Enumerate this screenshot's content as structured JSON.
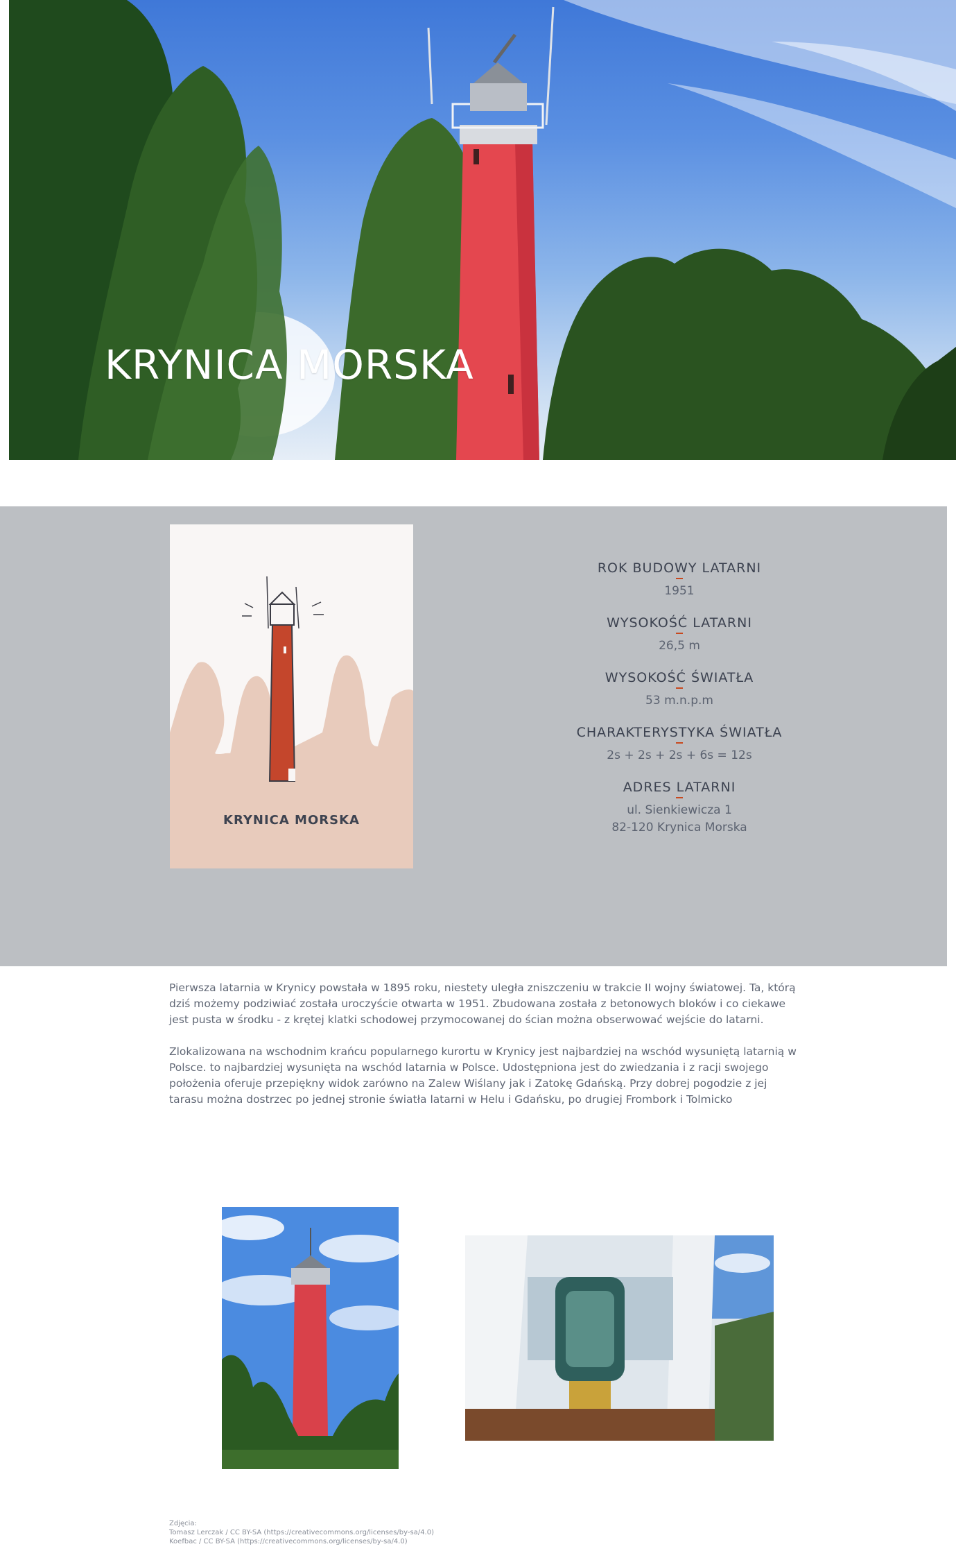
{
  "hero": {
    "title": "KRYNICA MORSKA"
  },
  "card": {
    "title": "KRYNICA MORSKA"
  },
  "facts": [
    {
      "label": "ROK BUDOWY LATARNI",
      "value": "1951"
    },
    {
      "label": "WYSOKOŚĆ LATARNI",
      "value": "26,5 m"
    },
    {
      "label": "WYSOKOŚĆ ŚWIATŁA",
      "value": "53 m.n.p.m"
    },
    {
      "label": "CHARAKTERYSTYKA ŚWIATŁA",
      "value": "2s + 2s + 2s + 6s = 12s"
    },
    {
      "label": "ADRES LATARNI",
      "value": "ul. Sienkiewicza 1\n82-120 Krynica Morska"
    }
  ],
  "description": [
    "Pierwsza latarnia w Krynicy powstała w 1895 roku, niestety uległa zniszczeniu w trakcie II wojny światowej. Ta, którą dziś możemy podziwiać została uroczyście otwarta w 1951. Zbudowana została z betonowych bloków i co ciekawe jest pusta w środku - z krętej klatki schodowej przymocowanej do ścian można obserwować wejście do latarni.",
    "Zlokalizowana na wschodnim krańcu popularnego kurortu w Krynicy jest najbardziej na wschód wysuniętą latarnią w Polsce.  to najbardziej wysunięta na wschód latarnia w Polsce. Udostępniona jest do zwiedzania i z racji swojego położenia oferuje przepiękny widok zarówno na Zalew Wiślany jak i Zatokę Gdańską. Przy dobrej pogodzie z jej tarasu można dostrzec po jednej stronie światła latarni w Helu i Gdańsku, po drugiej Frombork i Tolmicko"
  ],
  "credits": {
    "heading": "Zdjęcia:",
    "lines": [
      "Tomasz Lerczak / CC BY-SA (https://creativecommons.org/licenses/by-sa/4.0)",
      "Koefbac / CC BY-SA (https://creativecommons.org/licenses/by-sa/4.0)"
    ]
  },
  "colors": {
    "band": "#bcbfc3",
    "tower": "#e4474f",
    "card_tower": "#c4462c",
    "accent_rule": "#c8491f",
    "card_bg": "#f9f6f5",
    "card_ground": "#e8cbbc"
  }
}
